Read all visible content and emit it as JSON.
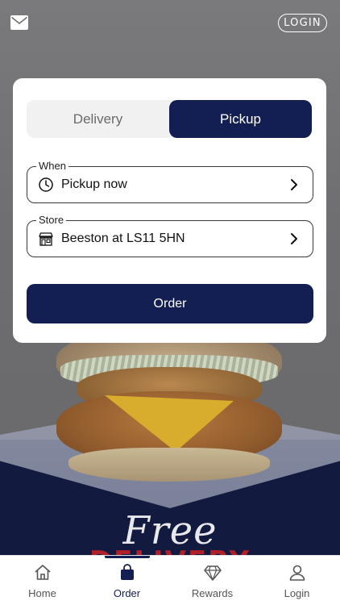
{
  "header": {
    "mail_icon": "envelope-icon",
    "login_label": "LOGIN"
  },
  "background": {
    "promo_text_line1": "Free",
    "promo_text_line2": "DELIVERY"
  },
  "order_card": {
    "mode_options": [
      {
        "label": "Delivery",
        "selected": false
      },
      {
        "label": "Pickup",
        "selected": true
      }
    ],
    "when": {
      "legend": "When",
      "value": "Pickup now",
      "icon": "clock-icon"
    },
    "store": {
      "legend": "Store",
      "value": "Beeston at LS11 5HN",
      "icon": "storefront-icon"
    },
    "order_button_label": "Order"
  },
  "tabbar": {
    "items": [
      {
        "label": "Home",
        "icon": "home-icon",
        "active": false
      },
      {
        "label": "Order",
        "icon": "bag-icon",
        "active": true
      },
      {
        "label": "Rewards",
        "icon": "diamond-icon",
        "active": false
      },
      {
        "label": "Login",
        "icon": "person-icon",
        "active": false
      }
    ]
  },
  "colors": {
    "brand_navy": "#131f52",
    "overlay_gray": "#6b6b6d",
    "white": "#ffffff"
  }
}
